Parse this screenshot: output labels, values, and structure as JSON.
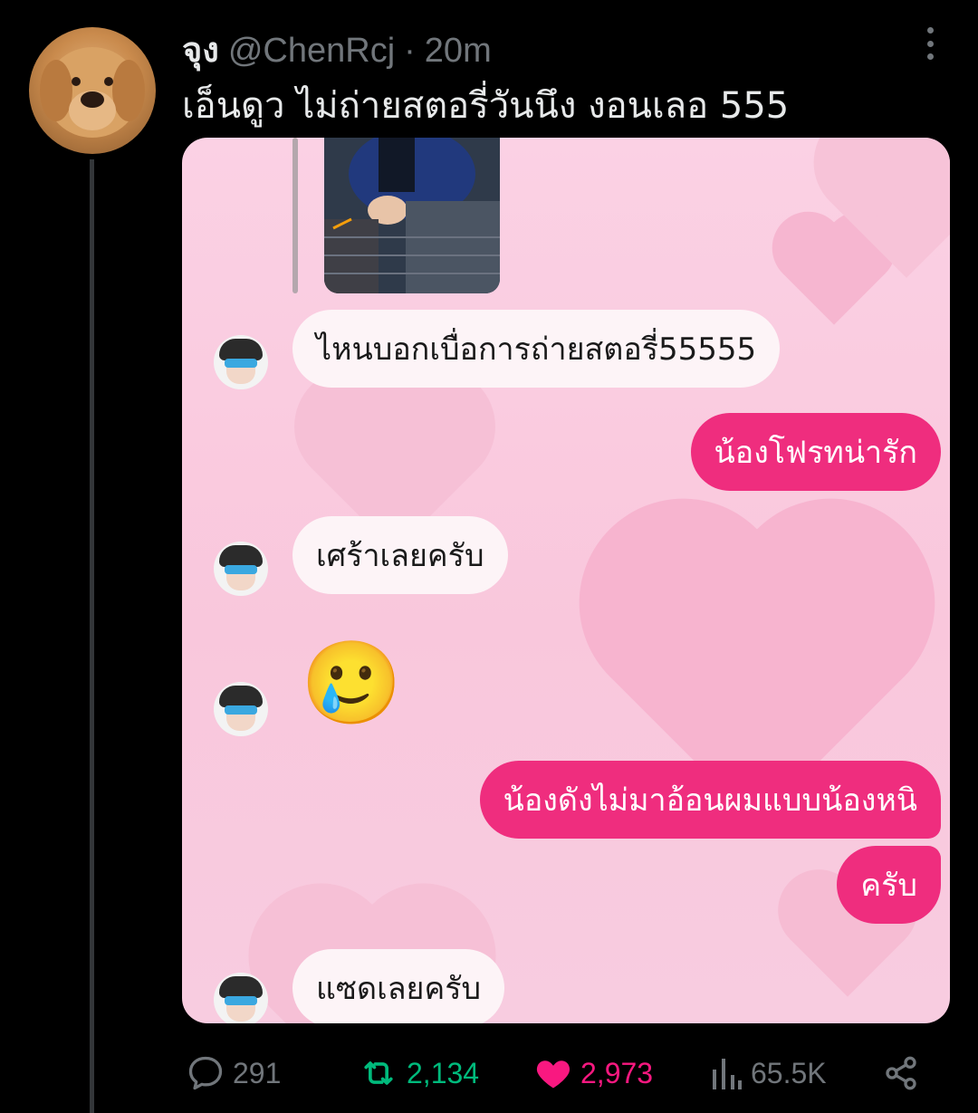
{
  "tweet": {
    "display_name": "จุง",
    "handle": "@ChenRcj",
    "separator": "·",
    "time": "20m",
    "text": "เอ็นดูว ไม่ถ่ายสตอรี่วันนึง งอนเลอ 555"
  },
  "chat": {
    "messages": [
      {
        "from": "them",
        "text": "ไหนบอกเบื่อการถ่ายสตอรี่55555"
      },
      {
        "from": "me",
        "text": "น้องโฟรทน่ารัก"
      },
      {
        "from": "them",
        "text": "เศร้าเลยครับ"
      },
      {
        "from": "them",
        "text": "🥲"
      },
      {
        "from": "me",
        "text": "น้องดังไม่มาอ้อนผมแบบน้องหนิ"
      },
      {
        "from": "me",
        "text": "ครับ"
      },
      {
        "from": "them",
        "text": "แซดเลยครับ"
      }
    ]
  },
  "actions": {
    "reply_count": "291",
    "retweet_count": "2,134",
    "like_count": "2,973",
    "views_count": "65.5K"
  },
  "colors": {
    "background": "#000000",
    "secondary_text": "#71767b",
    "retweet_green": "#00ba7c",
    "like_pink": "#f91880",
    "chat_bubble_out": "#ef2d7e",
    "chat_bubble_in": "#fdf4f7",
    "chat_background": "#f9c7dc"
  },
  "icons": {
    "reply": "reply-icon",
    "retweet": "retweet-icon",
    "like": "heart-icon",
    "views": "views-icon",
    "share": "share-icon",
    "more": "more-icon"
  }
}
